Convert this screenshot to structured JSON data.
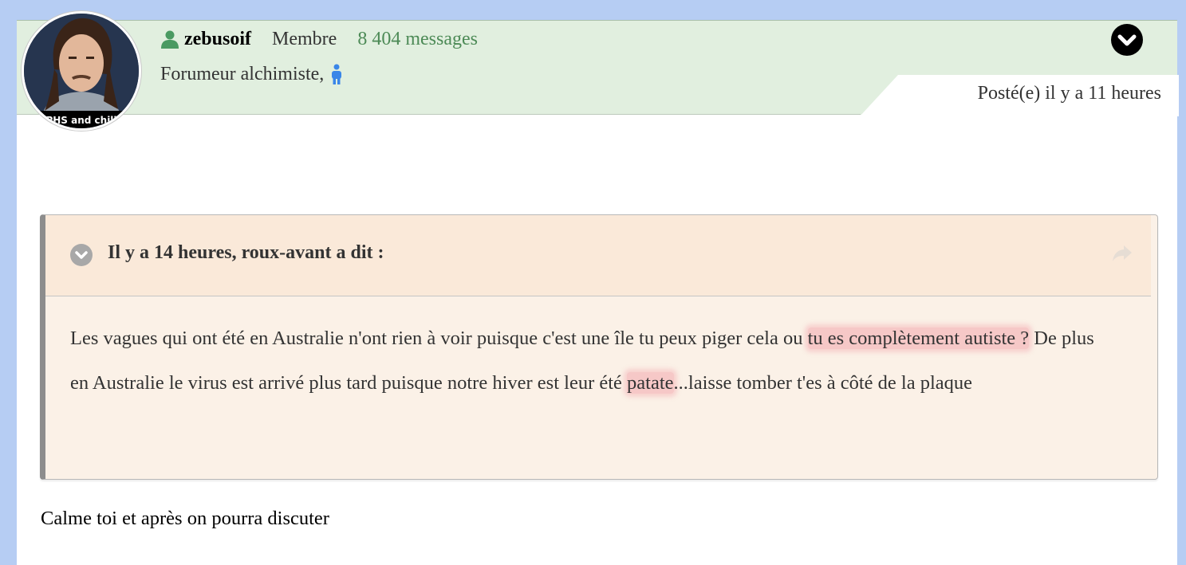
{
  "author": {
    "username": "zebusoif",
    "role": "Membre",
    "message_count": "8 404 messages",
    "title": "Forumeur alchimiste,",
    "avatar_caption": "PHS and chill"
  },
  "post": {
    "posted_time": "Posté(e) il y a 11 heures",
    "reply": "Calme toi et après on pourra discuter"
  },
  "quote": {
    "citation": "Il y a 14 heures, roux-avant a dit :",
    "body": {
      "part1": "Les vagues qui ont été en Australie n'ont rien à voir puisque c'est une île tu peux piger cela ou ",
      "highlight1": "tu es complètement autiste ?",
      "part2": " De plus en Australie le virus est arrivé plus tard puisque notre hiver est leur été ",
      "highlight2": "patate",
      "part3": "...laisse tomber t'es à côté de la plaque"
    }
  },
  "icons": {
    "user": "user-icon",
    "gender": "male-icon",
    "menu": "chevron-down-icon",
    "quote_toggle": "chevron-down-icon",
    "share": "share-arrow-icon"
  },
  "colors": {
    "page_background": "#b6cdf3",
    "header_background": "#e1efdf",
    "quote_header": "#fae9d9",
    "quote_body": "#fbf1e7",
    "message_count": "#4c8a56",
    "highlight": "#f096a0"
  }
}
